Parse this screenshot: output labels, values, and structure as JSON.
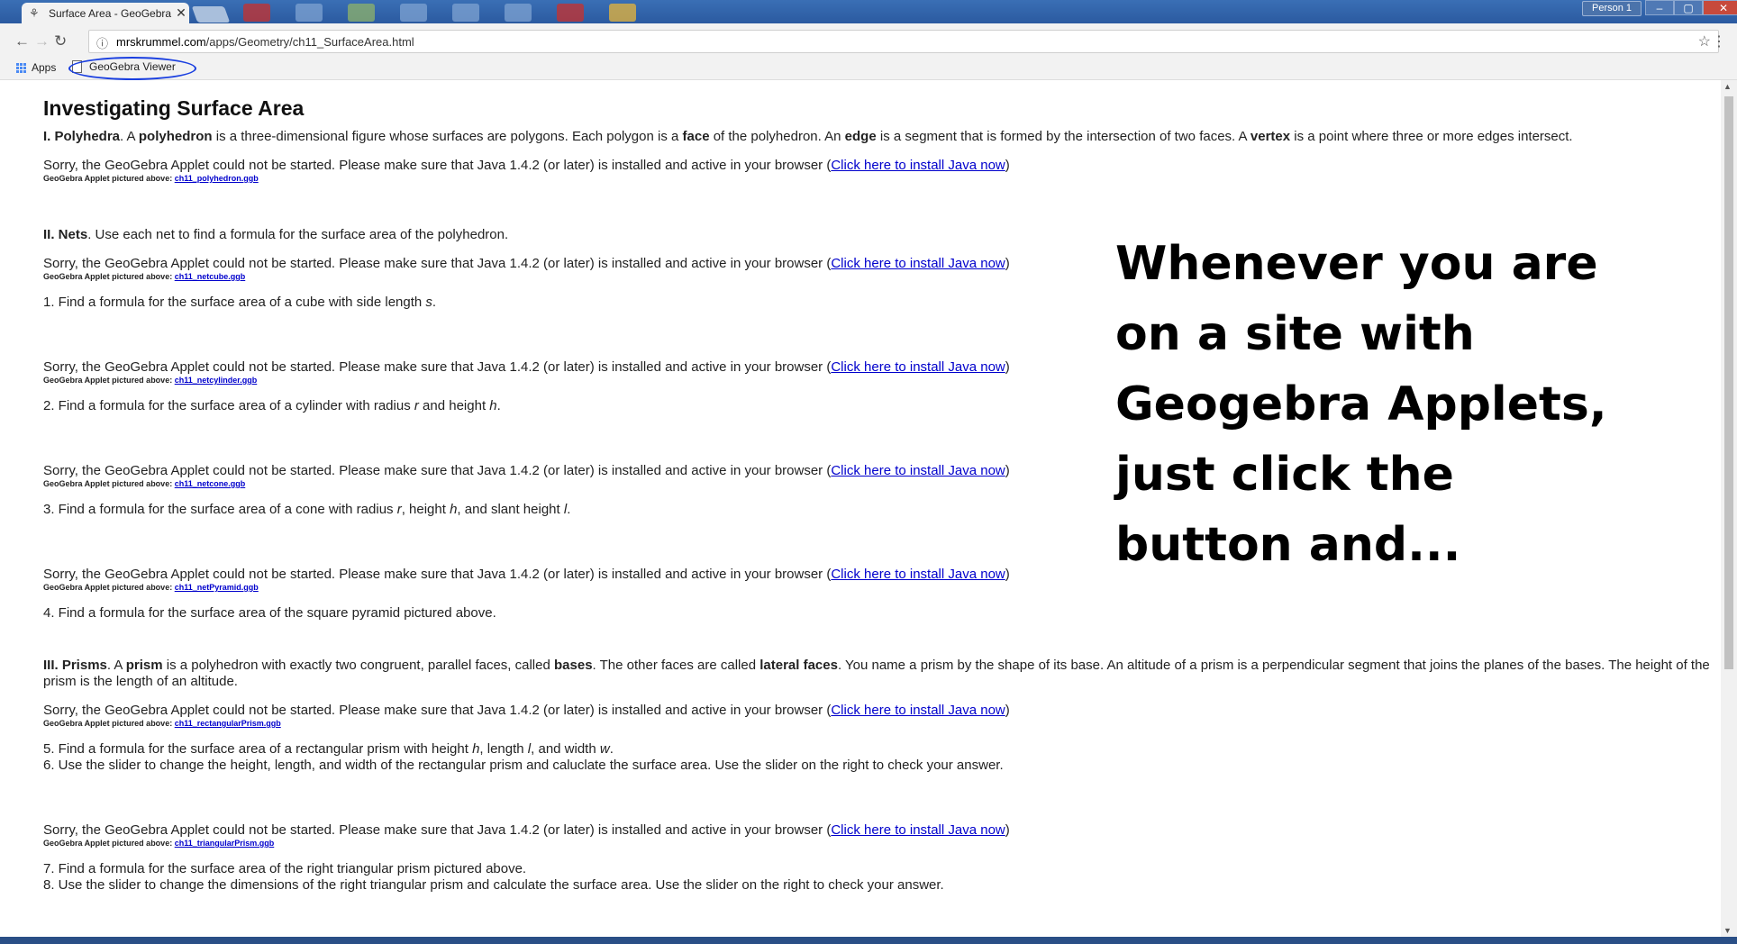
{
  "browser": {
    "tab_title": "Surface Area - GeoGebra",
    "tab_close": "✕",
    "profile": "Person 1",
    "window_buttons": [
      "–",
      "▢",
      "✕"
    ],
    "url_host": "mrskrummel.com",
    "url_path": "/apps/Geometry/ch11_SurfaceArea.html",
    "back_icon": "←",
    "forward_icon": "→",
    "reload_icon": "↻",
    "info_icon": "ⓘ",
    "star_icon": "☆",
    "menu_icon": "⋮",
    "bookmarks": {
      "apps_label": "Apps",
      "geogebra_label": "GeoGebra Viewer"
    }
  },
  "page": {
    "title": "Investigating Surface Area",
    "sorry_text": "Sorry, the GeoGebra Applet could not be started. Please make sure that Java 1.4.2 (or later) is installed and active in your browser (",
    "install_link": "Click here to install Java now",
    "sorry_close": ")",
    "caption_prefix": "GeoGebra Applet pictured above: ",
    "polyhedra": {
      "heading": "I. Polyhedra",
      "p1": ". A ",
      "b1": "polyhedron",
      "p2": " is a three-dimensional figure whose surfaces are polygons. Each polygon is a ",
      "b2": "face",
      "p3": " of the polyhedron. An ",
      "b3": "edge",
      "p4": " is a segment that is formed by the intersection of two faces. A ",
      "b4": "vertex",
      "p5": " is a point where three or more edges intersect.",
      "file": "ch11_polyhedron.ggb"
    },
    "nets": {
      "heading": "II. Nets",
      "text": ". Use each net to find a formula for the surface area of the polyhedron.",
      "file1": "ch11_netcube.ggb",
      "q1": "1. Find a formula for the surface area of a cube with side length ",
      "q1_var": "s",
      "q1_end": ".",
      "file2": "ch11_netcylinder.ggb",
      "q2": "2. Find a formula for the surface area of a cylinder with radius ",
      "q2_var1": "r",
      "q2_mid": " and height ",
      "q2_var2": "h",
      "q2_end": ".",
      "file3": "ch11_netcone.ggb",
      "q3": "3. Find a formula for the surface area of a cone with radius ",
      "q3_var1": "r",
      "q3_mid1": ", height ",
      "q3_var2": "h",
      "q3_mid2": ", and slant height ",
      "q3_var3": "l",
      "q3_end": ".",
      "file4": "ch11_netPyramid.ggb",
      "q4": "4. Find a formula for the surface area of the square pyramid pictured above."
    },
    "prisms": {
      "heading": "III. Prisms",
      "p1": ". A ",
      "b1": "prism",
      "p2": " is a polyhedron with exactly two congruent, parallel faces, called ",
      "b2": "bases",
      "p3": ". The other faces are called ",
      "b3": "lateral faces",
      "p4": ". You name a prism by the shape of its base. An altitude of a prism is a perpendicular segment that joins the planes of the bases. The height of the prism is the length of an altitude.",
      "file1": "ch11_rectangularPrism.ggb",
      "q5": "5. Find a formula for the surface area of a rectangular prism with height ",
      "q5_var1": "h",
      "q5_mid1": ", length ",
      "q5_var2": "l",
      "q5_mid2": ", and width ",
      "q5_var3": "w",
      "q5_end": ".",
      "q6": "6. Use the slider to change the height, length, and width of the rectangular prism and caluclate the surface area. Use the slider on the right to check your answer.",
      "file2": "ch11_triangularPrism.ggb",
      "q7": "7. Find a formula for the surface area of the right triangular prism pictured above.",
      "q8": "8. Use the slider to change the dimensions of the right triangular prism and calculate the surface area. Use the slider on the right to check your answer."
    }
  },
  "callout_lines": [
    "Whenever you are",
    "on a site with",
    "Geogebra Applets,",
    "just click the",
    "button and..."
  ],
  "colors": {
    "link": "#0000cc",
    "annotation_circle": "#1a3fe0",
    "window_frame": "#2b5aa0"
  }
}
